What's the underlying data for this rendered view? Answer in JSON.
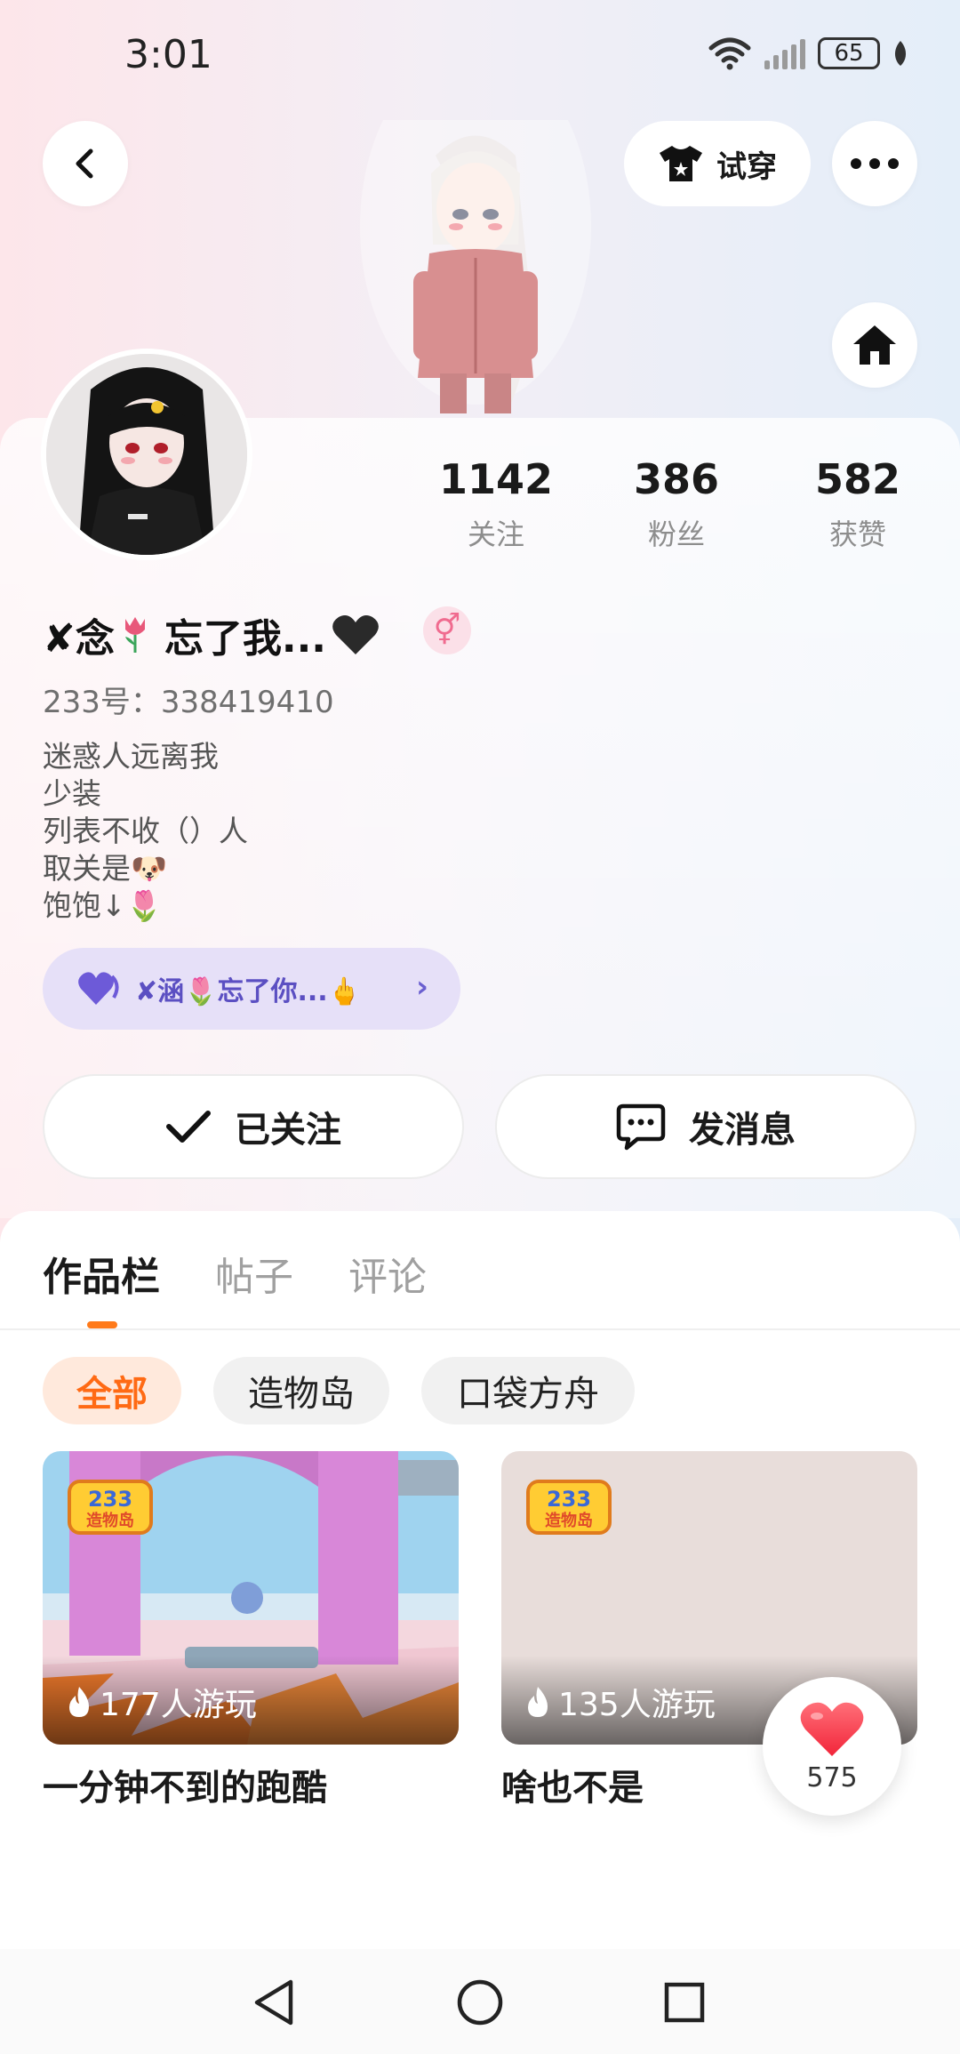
{
  "status_bar": {
    "time": "3:01",
    "battery": "65"
  },
  "header": {
    "try_on_label": "试穿"
  },
  "stats": [
    {
      "value": "1142",
      "label": "关注"
    },
    {
      "value": "386",
      "label": "粉丝"
    },
    {
      "value": "582",
      "label": "获赞"
    }
  ],
  "profile": {
    "nickname_a": "✘念",
    "nickname_b": "忘了我...",
    "gender_symbol": "⚥",
    "uid": "233号：338419410",
    "bio": [
      "迷惑人远离我",
      "少装",
      "列表不收（）人",
      "取关是🐶",
      "饱饱↓🌷"
    ]
  },
  "friend_link": {
    "text": "✘涵🌷忘了你...🖕",
    "chevron": "›"
  },
  "actions": {
    "followed_label": "已关注",
    "message_label": "发消息"
  },
  "tabs": [
    {
      "label": "作品栏",
      "active": true
    },
    {
      "label": "帖子",
      "active": false
    },
    {
      "label": "评论",
      "active": false
    }
  ],
  "filters": [
    {
      "label": "全部",
      "active": true
    },
    {
      "label": "造物岛",
      "active": false
    },
    {
      "label": "口袋方舟",
      "active": false
    }
  ],
  "games": [
    {
      "title": "一分钟不到的跑酷",
      "plays": "177人游玩",
      "badge": "233 造物岛"
    },
    {
      "title": "啥也不是",
      "plays": "135人游玩",
      "badge": "233 造物岛"
    }
  ],
  "like_bubble": {
    "count": "575"
  },
  "colors": {
    "accent": "#ff7a1a",
    "friend_pill": "#e6e0f8",
    "gender_pink": "#f06b8f"
  }
}
